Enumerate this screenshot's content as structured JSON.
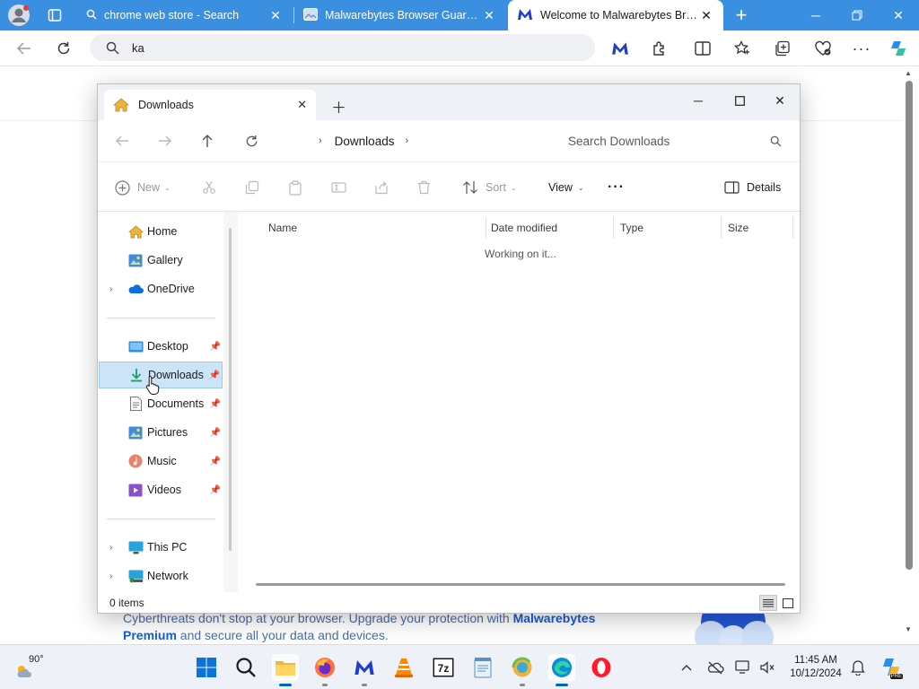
{
  "browser": {
    "tabs": [
      {
        "title": "chrome web store - Search",
        "active": false
      },
      {
        "title": "Malwarebytes Browser Guard - C",
        "active": false
      },
      {
        "title": "Welcome to Malwarebytes Brows",
        "active": true
      }
    ],
    "address_text": "ka",
    "new_tab_label": "+"
  },
  "page": {
    "promo_text": "Cyberthreats don't stop at your browser. Upgrade your protection with ",
    "promo_brand": "Malwarebytes",
    "promo_brand2": "Premium",
    "promo_rest": " and secure all your data and devices."
  },
  "explorer": {
    "tab_title": "Downloads",
    "breadcrumb": [
      "Downloads"
    ],
    "search_placeholder": "Search Downloads",
    "commands": {
      "new": "New",
      "sort": "Sort",
      "view": "View",
      "details": "Details"
    },
    "nav": {
      "home": "Home",
      "gallery": "Gallery",
      "onedrive": "OneDrive",
      "desktop": "Desktop",
      "downloads": "Downloads",
      "documents": "Documents",
      "pictures": "Pictures",
      "music": "Music",
      "videos": "Videos",
      "thispc": "This PC",
      "network": "Network"
    },
    "columns": [
      "Name",
      "Date modified",
      "Type",
      "Size"
    ],
    "working_text": "Working on it...",
    "status": "0 items"
  },
  "taskbar": {
    "temperature": "90°",
    "time": "11:45 AM",
    "date": "10/12/2024",
    "copilot_badge": "PRE"
  },
  "colors": {
    "tabbar": "#3a8fe0",
    "selection": "#cce4f7",
    "accent": "#0067c0"
  }
}
